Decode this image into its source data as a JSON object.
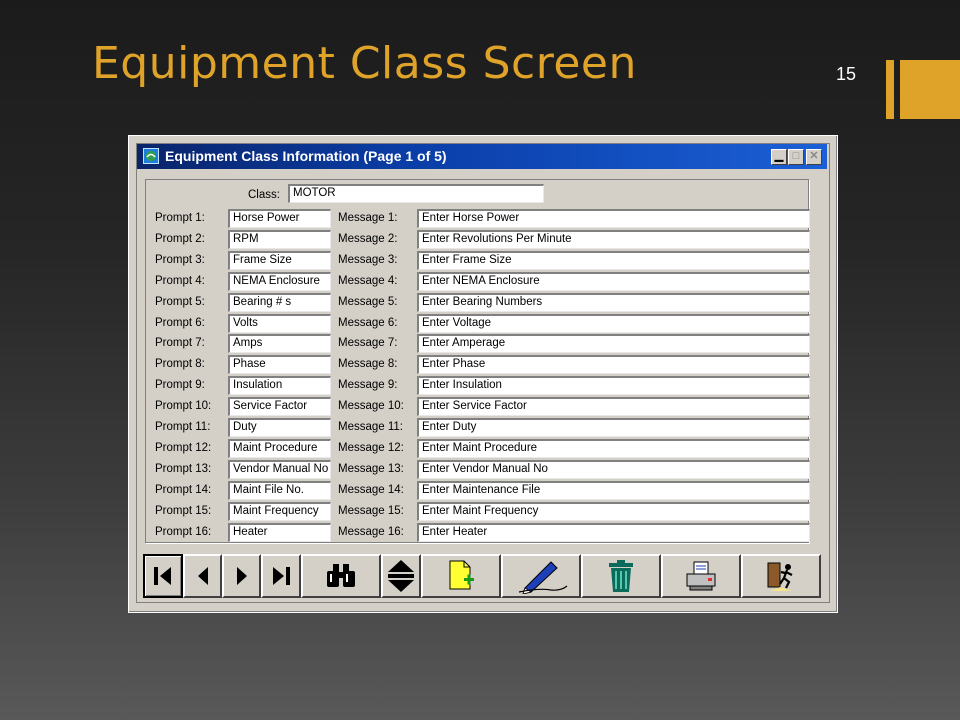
{
  "slide": {
    "title": "Equipment Class Screen",
    "number": "15"
  },
  "window": {
    "title": "Equipment Class Information (Page 1 of 5)",
    "min_glyph": "▁",
    "max_glyph": "□",
    "close_glyph": "✕"
  },
  "form": {
    "class_label": "Class:",
    "class_value": "MOTOR",
    "rows": [
      {
        "prompt_label": "Prompt 1:",
        "prompt": "Horse Power",
        "message_label": "Message 1:",
        "message": "Enter Horse Power"
      },
      {
        "prompt_label": "Prompt 2:",
        "prompt": "RPM",
        "message_label": "Message 2:",
        "message": "Enter Revolutions Per Minute"
      },
      {
        "prompt_label": "Prompt 3:",
        "prompt": "Frame Size",
        "message_label": "Message 3:",
        "message": "Enter Frame Size"
      },
      {
        "prompt_label": "Prompt 4:",
        "prompt": "NEMA Enclosure",
        "message_label": "Message 4:",
        "message": "Enter NEMA Enclosure"
      },
      {
        "prompt_label": "Prompt 5:",
        "prompt": "Bearing # s",
        "message_label": "Message 5:",
        "message": "Enter Bearing Numbers"
      },
      {
        "prompt_label": "Prompt 6:",
        "prompt": "Volts",
        "message_label": "Message 6:",
        "message": "Enter Voltage"
      },
      {
        "prompt_label": "Prompt 7:",
        "prompt": "Amps",
        "message_label": "Message 7:",
        "message": "Enter Amperage"
      },
      {
        "prompt_label": "Prompt 8:",
        "prompt": "Phase",
        "message_label": "Message 8:",
        "message": "Enter Phase"
      },
      {
        "prompt_label": "Prompt 9:",
        "prompt": "Insulation",
        "message_label": "Message 9:",
        "message": "Enter Insulation"
      },
      {
        "prompt_label": "Prompt 10:",
        "prompt": "Service Factor",
        "message_label": "Message 10:",
        "message": "Enter Service Factor"
      },
      {
        "prompt_label": "Prompt 11:",
        "prompt": "Duty",
        "message_label": "Message 11:",
        "message": "Enter Duty"
      },
      {
        "prompt_label": "Prompt 12:",
        "prompt": "Maint Procedure",
        "message_label": "Message 12:",
        "message": "Enter Maint Procedure"
      },
      {
        "prompt_label": "Prompt 13:",
        "prompt": "Vendor Manual No",
        "message_label": "Message 13:",
        "message": "Enter Vendor Manual No"
      },
      {
        "prompt_label": "Prompt 14:",
        "prompt": "Maint File No.",
        "message_label": "Message 14:",
        "message": "Enter Maintenance File"
      },
      {
        "prompt_label": "Prompt 15:",
        "prompt": "Maint Frequency",
        "message_label": "Message 15:",
        "message": "Enter Maint Frequency"
      },
      {
        "prompt_label": "Prompt 16:",
        "prompt": "Heater",
        "message_label": "Message 16:",
        "message": "Enter Heater"
      }
    ]
  },
  "toolbar": {
    "buttons": [
      {
        "name": "first-record-button",
        "icon": "first-record-icon"
      },
      {
        "name": "previous-record-button",
        "icon": "previous-record-icon"
      },
      {
        "name": "next-record-button",
        "icon": "next-record-icon"
      },
      {
        "name": "last-record-button",
        "icon": "last-record-icon"
      },
      {
        "name": "find-button",
        "icon": "binoculars-icon"
      },
      {
        "name": "scroll-page-button",
        "icon": "up-down-arrows-icon"
      },
      {
        "name": "new-record-button",
        "icon": "new-document-icon"
      },
      {
        "name": "edit-record-button",
        "icon": "pen-icon"
      },
      {
        "name": "delete-record-button",
        "icon": "trash-can-icon"
      },
      {
        "name": "print-button",
        "icon": "printer-icon"
      },
      {
        "name": "exit-button",
        "icon": "exit-door-icon"
      }
    ]
  },
  "colors": {
    "accent": "#e0a32a",
    "titlebar": "#0a246a",
    "window_face": "#d4d0c8"
  }
}
